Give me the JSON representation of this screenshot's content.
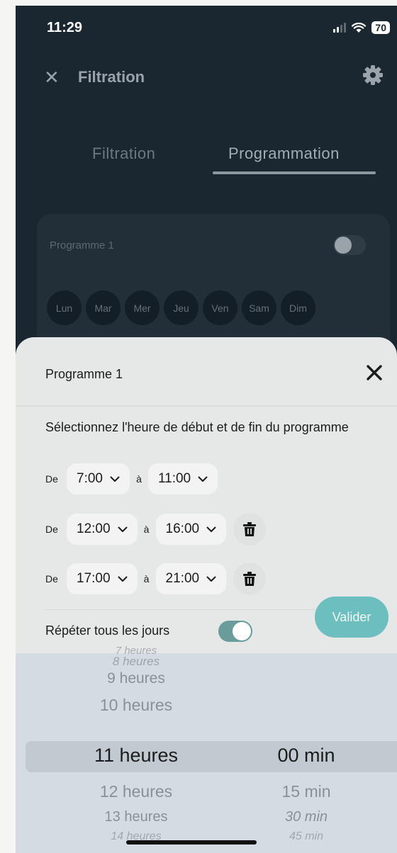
{
  "status_bar": {
    "time": "11:29",
    "battery": "70"
  },
  "header": {
    "title": "Filtration"
  },
  "tabs": [
    {
      "label": "Filtration",
      "active": false
    },
    {
      "label": "Programmation",
      "active": true
    }
  ],
  "program_card": {
    "title": "Programme 1",
    "enabled": false,
    "days": [
      "Lun",
      "Mar",
      "Mer",
      "Jeu",
      "Ven",
      "Sam",
      "Dim"
    ]
  },
  "sheet": {
    "title": "Programme 1",
    "instruction": "Sélectionnez l'heure de début et de fin du programme",
    "de_label": "De",
    "a_label": "à",
    "ranges": [
      {
        "start": "7:00",
        "end": "11:00",
        "deletable": false
      },
      {
        "start": "12:00",
        "end": "16:00",
        "deletable": true
      },
      {
        "start": "17:00",
        "end": "21:00",
        "deletable": true
      }
    ],
    "validate_label": "Valider",
    "repeat_label": "Répéter tous les jours",
    "repeat_enabled": true
  },
  "picker": {
    "hours": [
      "7 heures",
      "8 heures",
      "9 heures",
      "10 heures",
      "11 heures",
      "12 heures",
      "13 heures",
      "14 heures"
    ],
    "minutes": [
      "00 min",
      "15 min",
      "30 min",
      "45 min"
    ],
    "selected_hour": "11 heures",
    "selected_minute": "00 min"
  },
  "colors": {
    "accent": "#6dbfbf",
    "background_dark": "#1a2630",
    "sheet": "#e6e7e7"
  }
}
